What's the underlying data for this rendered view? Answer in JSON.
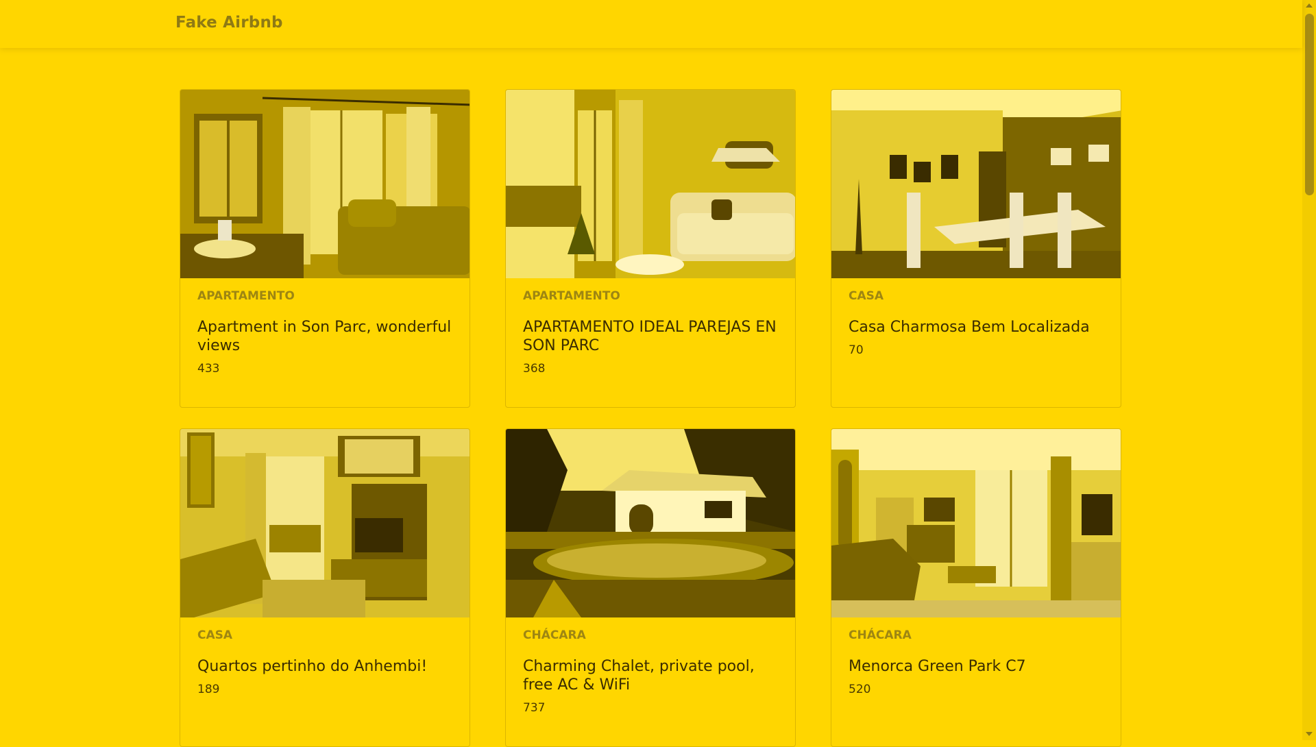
{
  "navbar": {
    "brand": "Fake Airbnb"
  },
  "listings": [
    {
      "type": "APARTAMENTO",
      "title": "Apartment in Son Parc, wonderful views",
      "price": "433",
      "photo": "living-room-photo"
    },
    {
      "type": "APARTAMENTO",
      "title": "APARTAMENTO IDEAL PAREJAS EN SON PARC",
      "price": "368",
      "photo": "sofa-room-photo"
    },
    {
      "type": "CASA",
      "title": "Casa Charmosa Bem Localizada",
      "price": "70",
      "photo": "dining-room-photo"
    },
    {
      "type": "CASA",
      "title": "Quartos pertinho do Anhembi!",
      "price": "189",
      "photo": "tv-room-photo"
    },
    {
      "type": "CHÁCARA",
      "title": "Charming Chalet, private pool, free AC & WiFi",
      "price": "737",
      "photo": "chalet-pool-photo"
    },
    {
      "type": "CHÁCARA",
      "title": "Menorca Green Park C7",
      "price": "520",
      "photo": "lounge-photo"
    }
  ],
  "colors": {
    "background": "#FFD600",
    "brand_text": "#8F7A14",
    "type_text": "#9E8612",
    "title_text": "#3A2C00"
  }
}
